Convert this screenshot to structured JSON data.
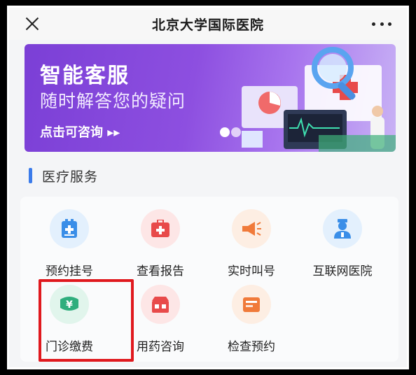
{
  "header": {
    "title": "北京大学国际医院"
  },
  "banner": {
    "title": "智能客服",
    "subtitle": "随时解答您的疑问",
    "cta": "点击可咨询 ▸▸"
  },
  "section": {
    "title": "医疗服务"
  },
  "services": [
    {
      "label": "预约挂号",
      "icon": "calendar-doc-icon",
      "color": "#3a8ee8"
    },
    {
      "label": "查看报告",
      "icon": "medical-kit-icon",
      "color": "#e84a4a"
    },
    {
      "label": "实时叫号",
      "icon": "megaphone-icon",
      "color": "#f07a3a"
    },
    {
      "label": "互联网医院",
      "icon": "doctor-icon",
      "color": "#3a8ee8"
    },
    {
      "label": "门诊缴费",
      "icon": "yen-payment-icon",
      "color": "#2fae7d"
    },
    {
      "label": "用药咨询",
      "icon": "pharmacy-icon",
      "color": "#e84a4a"
    },
    {
      "label": "检查预约",
      "icon": "schedule-icon",
      "color": "#f07a3a"
    }
  ]
}
